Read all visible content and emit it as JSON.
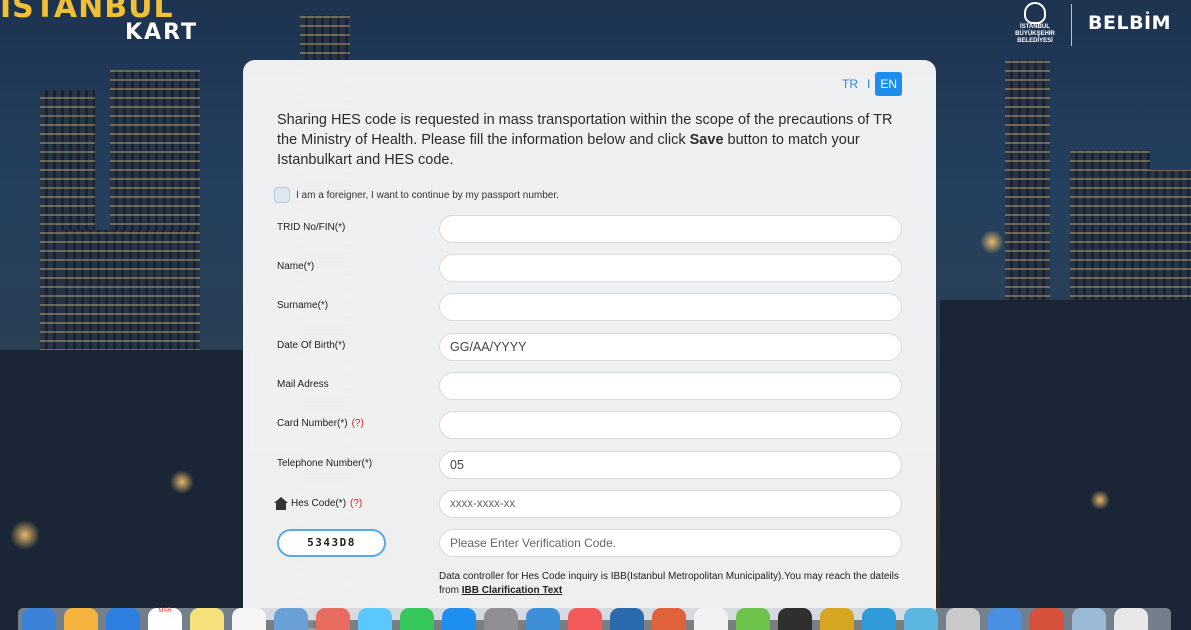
{
  "header": {
    "logo_istanbul": "İSTANBUL",
    "logo_kart": "KART",
    "ibb_logo_text": [
      "İSTANBUL",
      "BÜYÜKŞEHİR",
      "BELEDİYESİ"
    ],
    "belbim_logo": "BELBİM"
  },
  "lang": {
    "tr": "TR",
    "separator": "I",
    "en": "EN",
    "active": "EN"
  },
  "intro": {
    "before": "Sharing HES code is requested in mass transportation within the scope of the precautions of TR the Ministry of Health. Please fill the information below and click ",
    "bold": "Save",
    "after": " button to match your Istanbulkart and HES code."
  },
  "foreigner_checkbox": {
    "label": "I am a foreigner, I want to continue by my passport number.",
    "checked": false
  },
  "fields": [
    {
      "label": "TRID No/FIN(*)",
      "value": "",
      "placeholder": ""
    },
    {
      "label": "Name(*)",
      "value": "",
      "placeholder": ""
    },
    {
      "label": "Surname(*)",
      "value": "",
      "placeholder": ""
    },
    {
      "label": "Date Of Birth(*)",
      "value": "GG/AA/YYYY",
      "placeholder": ""
    },
    {
      "label": "Mail Adress",
      "value": "",
      "placeholder": ""
    },
    {
      "label": "Card Number(*)",
      "help": "(?)",
      "value": "",
      "placeholder": ""
    },
    {
      "label": "Telephone Number(*)",
      "value": "05",
      "placeholder": ""
    },
    {
      "label": "Hes Code(*)",
      "help": "(?)",
      "value": "",
      "placeholder": "xxxx-xxxx-xx"
    }
  ],
  "captcha": {
    "code": "5343D8",
    "input_placeholder": "Please Enter Verification Code."
  },
  "note": {
    "text": "Data controller for Hes Code inquiry is IBB(Istanbul Metropolitan Municipality).You may reach the dateils from ",
    "link": "IBB Clarification Text"
  },
  "dock": {
    "apps": [
      "finder-icon",
      "contacts-icon",
      "safari-icon",
      "calendar-icon",
      "notes-icon",
      "reminders-icon",
      "preview-icon",
      "photos-icon",
      "messages-icon",
      "facetime-icon",
      "app-store-icon",
      "settings-icon",
      "app-icon",
      "music-icon",
      "app-icon",
      "app-icon",
      "app-icon",
      "app-icon",
      "app-icon",
      "app-icon",
      "app-icon",
      "app-icon",
      "app-icon",
      "app-icon",
      "folder-icon",
      "document-icon",
      "trash-icon"
    ],
    "calendar_month": "MAR",
    "colors": [
      "#3b82d8",
      "#f3b33d",
      "#2f7fe0",
      "#ffffff",
      "#f6e07a",
      "#f5f5f5",
      "#6aa0d6",
      "#e86b5f",
      "#5ac8fa",
      "#35c759",
      "#1e8ef0",
      "#8e8e93",
      "#3f8ed8",
      "#f45a5a",
      "#2a6bb0",
      "#e0623b",
      "#f2f2f2",
      "#6cc24a",
      "#2f2f2f",
      "#d6a620",
      "#2f9bd8",
      "#5bb6e0",
      "#c9c9c9",
      "#4a90e2",
      "#d7503a",
      "#9bb9d6",
      "#e8e8e8",
      "#d0d0d0"
    ]
  }
}
